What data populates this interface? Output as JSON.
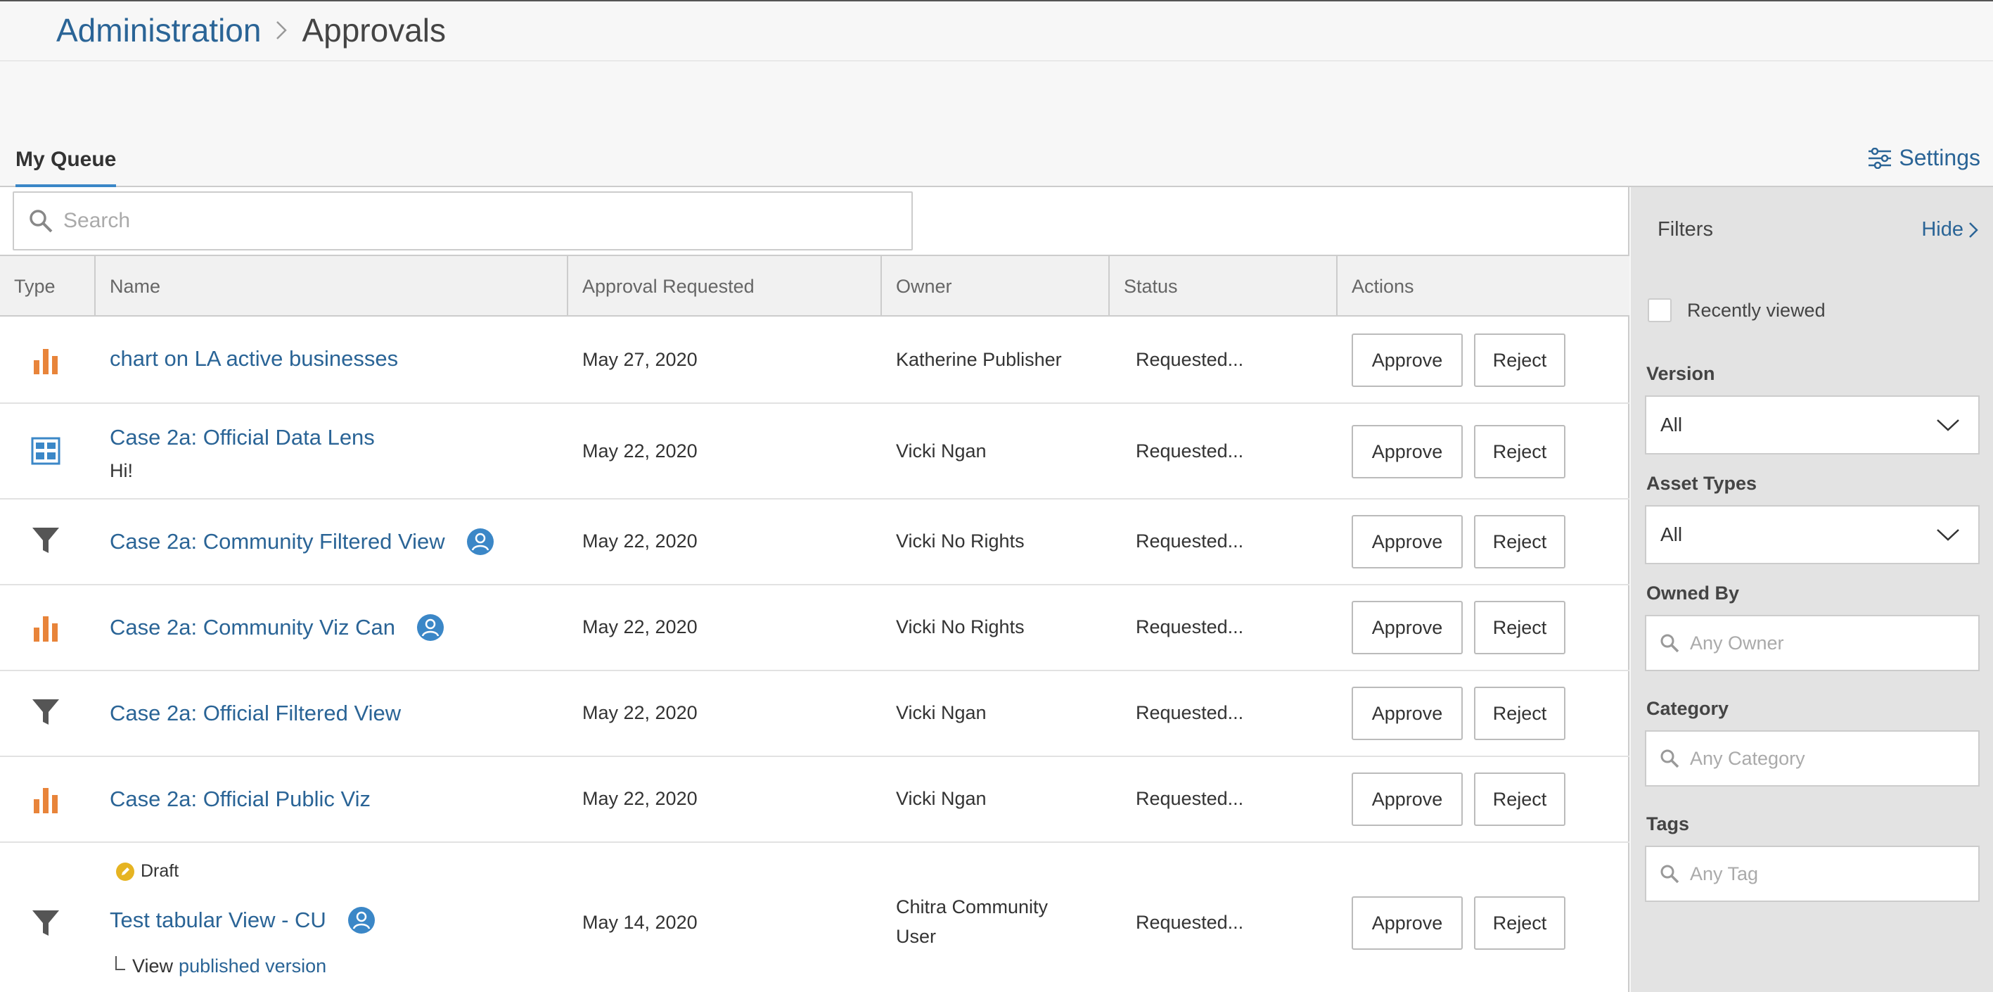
{
  "breadcrumb": {
    "parent": "Administration",
    "current": "Approvals"
  },
  "tabs": {
    "active": "My Queue"
  },
  "settings_label": "Settings",
  "search": {
    "placeholder": "Search"
  },
  "table": {
    "headers": {
      "type": "Type",
      "name": "Name",
      "approval_requested": "Approval Requested",
      "owner": "Owner",
      "status": "Status",
      "actions": "Actions"
    },
    "approve_label": "Approve",
    "reject_label": "Reject",
    "rows": [
      {
        "type_icon": "chart-icon",
        "name": "chart on LA active businesses",
        "date": "May 27, 2020",
        "owner": "Katherine Publisher",
        "status": "Requested..."
      },
      {
        "type_icon": "data-lens-icon",
        "name": "Case 2a: Official Data Lens",
        "subtitle": "Hi!",
        "date": "May 22, 2020",
        "owner": "Vicki Ngan",
        "status": "Requested..."
      },
      {
        "type_icon": "filter-icon",
        "name": "Case 2a: Community Filtered View",
        "community": true,
        "date": "May 22, 2020",
        "owner": "Vicki No Rights",
        "status": "Requested..."
      },
      {
        "type_icon": "chart-icon",
        "name": "Case 2a: Community Viz Can",
        "community": true,
        "date": "May 22, 2020",
        "owner": "Vicki No Rights",
        "status": "Requested..."
      },
      {
        "type_icon": "filter-icon",
        "name": "Case 2a: Official Filtered View",
        "date": "May 22, 2020",
        "owner": "Vicki Ngan",
        "status": "Requested..."
      },
      {
        "type_icon": "chart-icon",
        "name": "Case 2a: Official Public Viz",
        "date": "May 22, 2020",
        "owner": "Vicki Ngan",
        "status": "Requested..."
      },
      {
        "type_icon": "filter-icon",
        "draft_label": "Draft",
        "name": "Test tabular View - CU",
        "community": true,
        "date": "May 14, 2020",
        "owner_line1": "Chitra Community",
        "owner_line2": "User",
        "status": "Requested...",
        "view_prefix": "View",
        "view_link": "published version"
      }
    ]
  },
  "filters": {
    "title": "Filters",
    "hide_label": "Hide",
    "recently_viewed": "Recently viewed",
    "version_label": "Version",
    "version_value": "All",
    "asset_types_label": "Asset Types",
    "asset_types_value": "All",
    "owned_by_label": "Owned By",
    "owned_by_placeholder": "Any Owner",
    "category_label": "Category",
    "category_placeholder": "Any Category",
    "tags_label": "Tags",
    "tags_placeholder": "Any Tag"
  },
  "colors": {
    "link": "#2a6496",
    "accent": "#3b87c7",
    "chart_orange": "#e8843a",
    "community_blue": "#3b87c7",
    "draft_yellow": "#e6b422"
  }
}
